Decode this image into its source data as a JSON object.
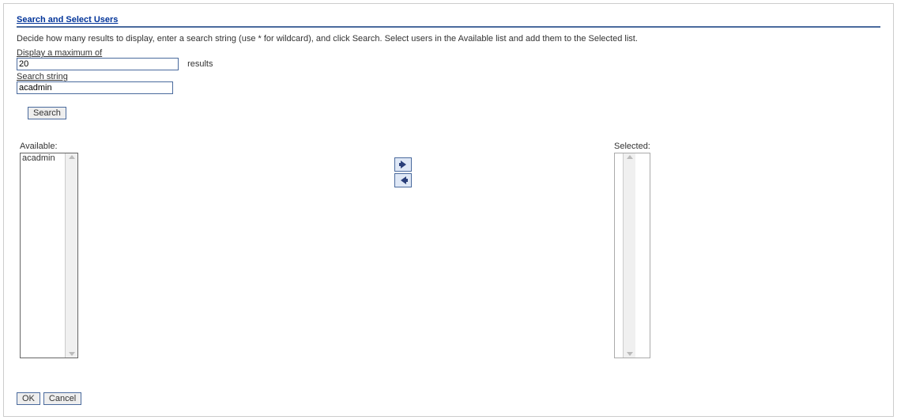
{
  "title": "Search and Select Users",
  "instructions": "Decide how many results to display, enter a search string (use * for wildcard), and click Search. Select users in the Available list and add them to the Selected list.",
  "fields": {
    "max_label": "Display a maximum of",
    "max_value": "20",
    "results_suffix": "results",
    "search_label": "Search string",
    "search_value": "acadmin"
  },
  "buttons": {
    "search": "Search",
    "ok": "OK",
    "cancel": "Cancel"
  },
  "shuttle": {
    "available_label": "Available:",
    "selected_label": "Selected:",
    "available_items": [
      "acadmin"
    ],
    "selected_items": []
  }
}
